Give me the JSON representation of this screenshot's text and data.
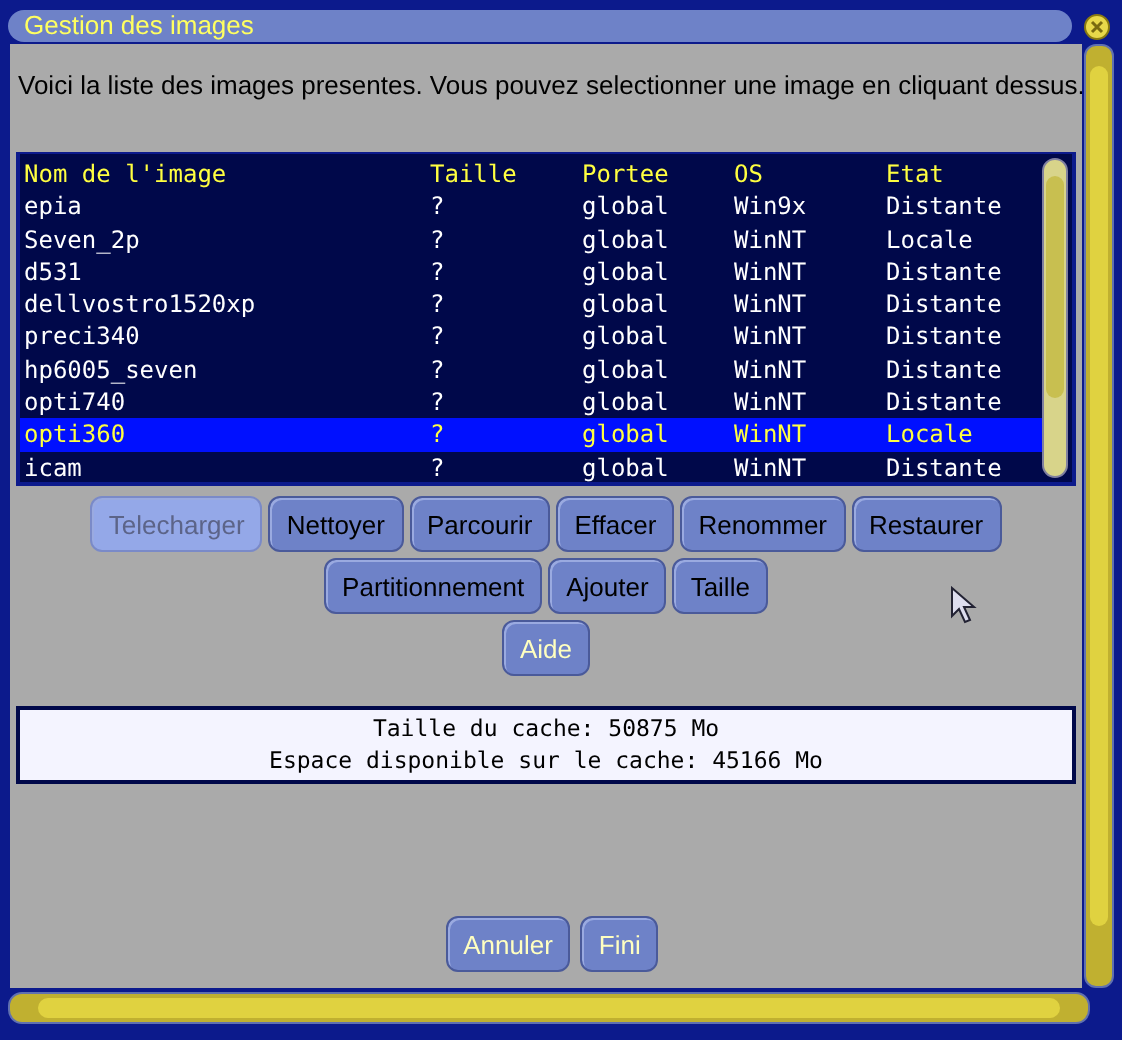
{
  "window": {
    "title": "Gestion des images"
  },
  "intro": "Voici la liste des images presentes. Vous pouvez selectionner une image en cliquant dessus.",
  "table": {
    "columns": [
      "Nom de l'image",
      "Taille",
      "Portee",
      "OS",
      "Etat"
    ],
    "rows": [
      {
        "cells": [
          "epia",
          "?",
          "global",
          "Win9x",
          "Distante"
        ],
        "selected": false
      },
      {
        "cells": [
          "Seven_2p",
          "?",
          "global",
          "WinNT",
          "Locale"
        ],
        "selected": false
      },
      {
        "cells": [
          "d531",
          "?",
          "global",
          "WinNT",
          "Distante"
        ],
        "selected": false
      },
      {
        "cells": [
          "dellvostro1520xp",
          "?",
          "global",
          "WinNT",
          "Distante"
        ],
        "selected": false
      },
      {
        "cells": [
          "preci340",
          "?",
          "global",
          "WinNT",
          "Distante"
        ],
        "selected": false
      },
      {
        "cells": [
          "hp6005_seven",
          "?",
          "global",
          "WinNT",
          "Distante"
        ],
        "selected": false
      },
      {
        "cells": [
          "opti740",
          "?",
          "global",
          "WinNT",
          "Distante"
        ],
        "selected": false
      },
      {
        "cells": [
          "opti360",
          "?",
          "global",
          "WinNT",
          "Locale"
        ],
        "selected": true
      },
      {
        "cells": [
          "icam",
          "?",
          "global",
          "WinNT",
          "Distante"
        ],
        "selected": false
      }
    ]
  },
  "button_rows": [
    [
      {
        "label": "Telecharger",
        "disabled": true,
        "emphasized": false
      },
      {
        "label": "Nettoyer",
        "disabled": false,
        "emphasized": false
      },
      {
        "label": "Parcourir",
        "disabled": false,
        "emphasized": false
      },
      {
        "label": "Effacer",
        "disabled": false,
        "emphasized": false
      },
      {
        "label": "Renommer",
        "disabled": false,
        "emphasized": false
      },
      {
        "label": "Restaurer",
        "disabled": false,
        "emphasized": false
      }
    ],
    [
      {
        "label": "Partitionnement",
        "disabled": false,
        "emphasized": false
      },
      {
        "label": "Ajouter",
        "disabled": false,
        "emphasized": false
      },
      {
        "label": "Taille",
        "disabled": false,
        "emphasized": false
      }
    ],
    [
      {
        "label": "Aide",
        "disabled": false,
        "emphasized": true
      }
    ]
  ],
  "cache_info": [
    "Taille du cache: 50875 Mo",
    "Espace disponible sur le cache: 45166 Mo"
  ],
  "footer_buttons": [
    {
      "label": "Annuler",
      "disabled": false,
      "emphasized": true
    },
    {
      "label": "Fini",
      "disabled": false,
      "emphasized": true
    }
  ]
}
